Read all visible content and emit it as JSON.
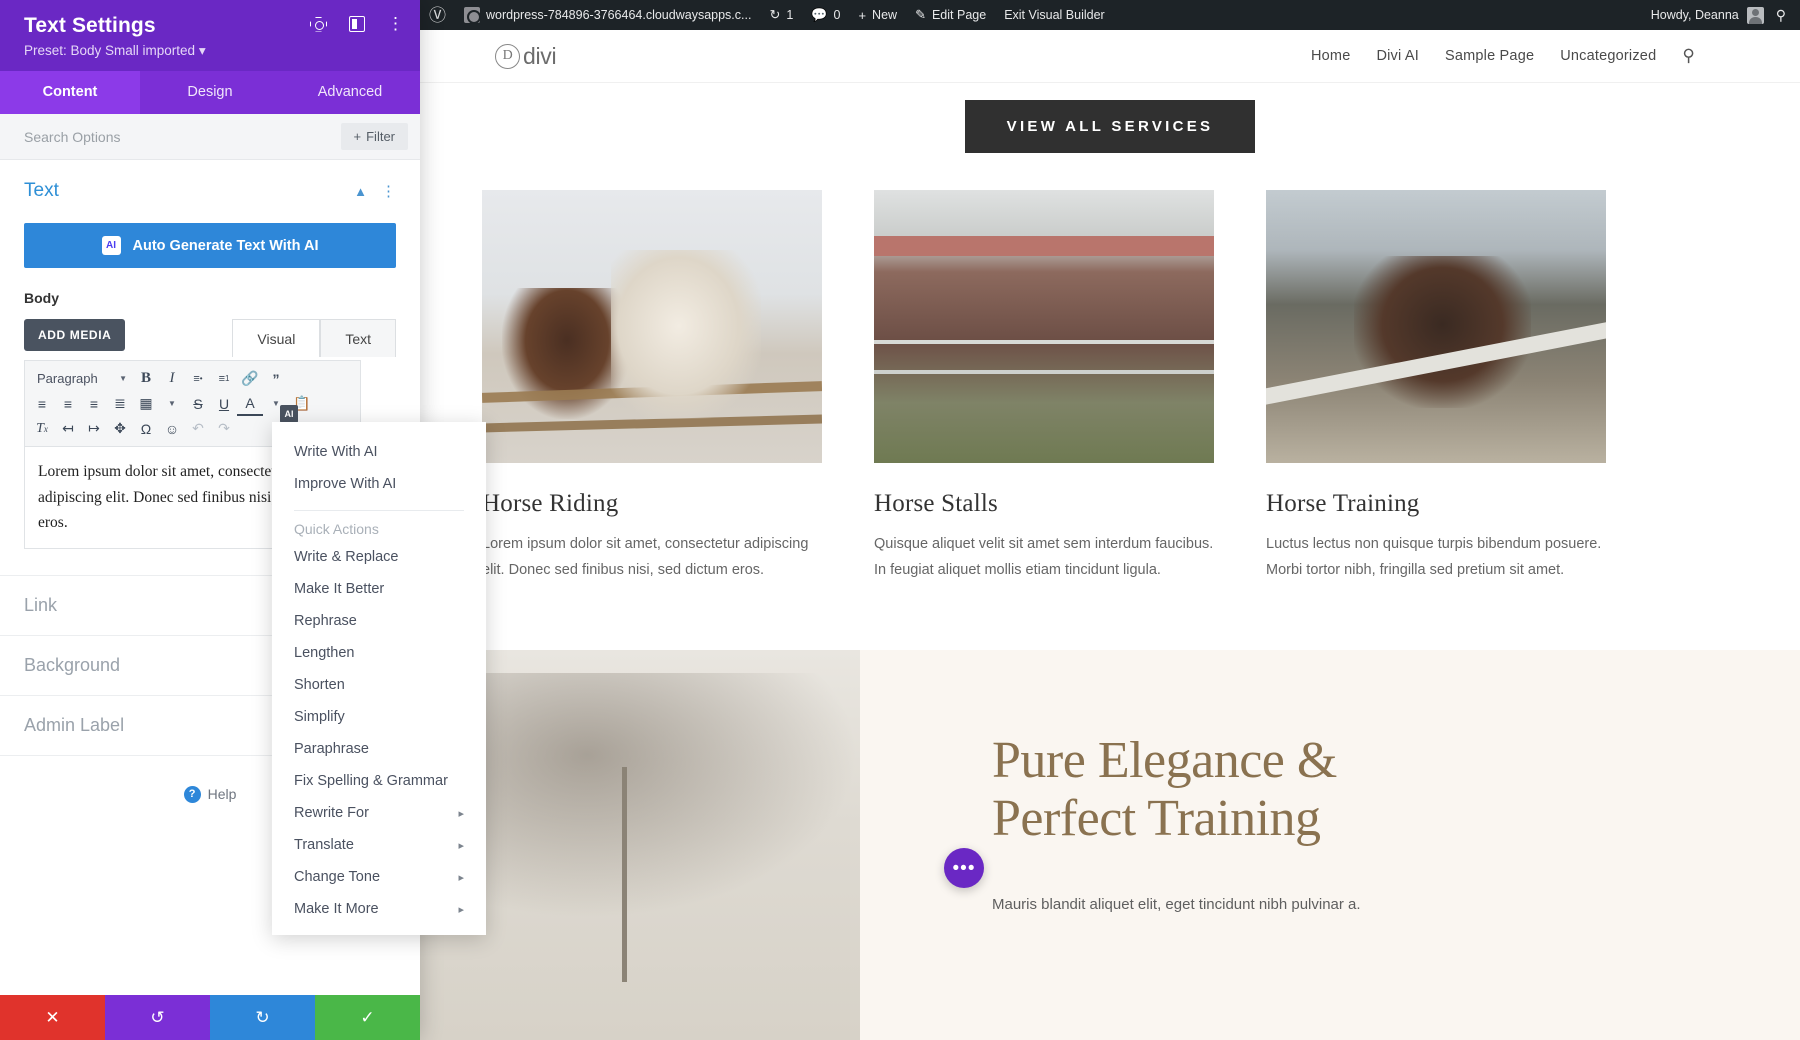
{
  "adminbar": {
    "wp_logo_icon": "wordpress-icon",
    "site_icon": "site-icon",
    "site_name": "wordpress-784896-3766464.cloudwaysapps.c...",
    "updates_icon": "refresh-icon",
    "updates_count": "1",
    "comments_icon": "comment-icon",
    "comments_count": "0",
    "new_icon": "plus-icon",
    "new_label": "New",
    "edit_icon": "pencil-icon",
    "edit_label": "Edit Page",
    "exit_label": "Exit Visual Builder",
    "howdy": "Howdy, Deanna",
    "avatar_icon": "avatar-icon",
    "search_icon": "search-icon"
  },
  "site_header": {
    "logo_mark": "D",
    "logo_text": "divi",
    "nav": [
      "Home",
      "Divi AI",
      "Sample Page",
      "Uncategorized"
    ],
    "search_icon": "search-icon"
  },
  "hero": {
    "cta_label": "VIEW ALL SERVICES"
  },
  "cards": [
    {
      "image_name": "horse-riding-photo",
      "title": "Horse Riding",
      "body": "Lorem ipsum dolor sit amet, consectetur adipiscing elit. Donec sed finibus nisi, sed dictum eros."
    },
    {
      "image_name": "horse-stalls-photo",
      "title": "Horse Stalls",
      "body": "Quisque aliquet velit sit amet sem interdum faucibus. In feugiat aliquet mollis etiam tincidunt ligula."
    },
    {
      "image_name": "horse-training-photo",
      "title": "Horse Training",
      "body": "Luctus lectus non quisque turpis bibendum posuere. Morbi tortor nibh, fringilla sed pretium sit amet."
    }
  ],
  "lower_section": {
    "image_name": "winter-tree-photo",
    "title_line1": "Pure Elegance &",
    "title_line2": "Perfect Training",
    "subtitle": "Mauris blandit aliquet elit, eget tincidunt nibh pulvinar a.",
    "fab_label": "•••"
  },
  "panel": {
    "title": "Text Settings",
    "preset": "Preset: Body Small imported ▾",
    "header_icons": [
      "focus-icon",
      "layout-panel-icon",
      "kebab-menu-icon"
    ],
    "tabs": [
      {
        "label": "Content",
        "active": true
      },
      {
        "label": "Design",
        "active": false
      },
      {
        "label": "Advanced",
        "active": false
      }
    ],
    "search_placeholder": "Search Options",
    "filter_label": "Filter",
    "filter_icon": "plus-icon",
    "section": {
      "name": "Text",
      "collapse_icon": "chevron-up-icon",
      "menu_icon": "kebab-menu-icon",
      "ai_button_label": "Auto Generate Text With AI",
      "ai_button_badge": "AI",
      "ai_button_color": "#2e87d9",
      "field_label": "Body",
      "add_media_label": "ADD MEDIA",
      "editor_tabs": [
        {
          "label": "Visual",
          "active": true
        },
        {
          "label": "Text",
          "active": false
        }
      ],
      "toolbar_row1": [
        {
          "icon": "paragraph-format-select",
          "label": "Paragraph",
          "caret": "▾"
        },
        {
          "icon": "bold-icon",
          "label": "B"
        },
        {
          "icon": "italic-icon",
          "label": "I"
        },
        {
          "icon": "bulleted-list-icon",
          "label": "☰"
        },
        {
          "icon": "numbered-list-icon",
          "label": "☰"
        },
        {
          "icon": "link-icon",
          "label": "🔗"
        },
        {
          "icon": "blockquote-icon",
          "label": "❝"
        }
      ],
      "toolbar_row2": [
        {
          "icon": "align-left-icon"
        },
        {
          "icon": "align-center-icon"
        },
        {
          "icon": "align-right-icon"
        },
        {
          "icon": "align-justify-icon"
        },
        {
          "icon": "table-icon"
        },
        {
          "icon": "strikethrough-icon",
          "label": "S"
        },
        {
          "icon": "underline-icon",
          "label": "U"
        },
        {
          "icon": "text-color-icon",
          "label": "A"
        },
        {
          "icon": "paste-as-text-icon"
        }
      ],
      "toolbar_row3": [
        {
          "icon": "clear-formatting-icon",
          "label": "Tx"
        },
        {
          "icon": "outdent-icon"
        },
        {
          "icon": "indent-icon"
        },
        {
          "icon": "fullscreen-icon"
        },
        {
          "icon": "special-character-icon",
          "label": "Ω"
        },
        {
          "icon": "emoji-icon",
          "label": "☺"
        },
        {
          "icon": "undo-icon",
          "label": "↶"
        },
        {
          "icon": "redo-icon",
          "label": "↷"
        }
      ],
      "editor_content": "Lorem ipsum dolor sit amet, consectetur adipiscing elit. Donec sed finibus nisi, sed dictum eros.",
      "ai_chip_label": "AI"
    },
    "accordions": [
      "Link",
      "Background",
      "Admin Label"
    ],
    "help_label": "Help",
    "help_icon": "question-icon",
    "footer_buttons": [
      {
        "icon": "close-icon",
        "label": "✕",
        "color": "#e0332c"
      },
      {
        "icon": "undo-icon",
        "label": "↺",
        "color": "#7b2fd6"
      },
      {
        "icon": "redo-icon",
        "label": "↻",
        "color": "#2e87d9"
      }
    ]
  },
  "ai_menu": {
    "primary": [
      "Write With AI",
      "Improve With AI"
    ],
    "group_label": "Quick Actions",
    "actions": [
      {
        "label": "Write & Replace",
        "submenu": false
      },
      {
        "label": "Make It Better",
        "submenu": false
      },
      {
        "label": "Rephrase",
        "submenu": false
      },
      {
        "label": "Lengthen",
        "submenu": false
      },
      {
        "label": "Shorten",
        "submenu": false
      },
      {
        "label": "Simplify",
        "submenu": false
      },
      {
        "label": "Paraphrase",
        "submenu": false
      },
      {
        "label": "Fix Spelling & Grammar",
        "submenu": false
      },
      {
        "label": "Rewrite For",
        "submenu": true
      },
      {
        "label": "Translate",
        "submenu": true
      },
      {
        "label": "Change Tone",
        "submenu": true
      },
      {
        "label": "Make It More",
        "submenu": true
      }
    ],
    "submenu_arrow": "▸"
  }
}
